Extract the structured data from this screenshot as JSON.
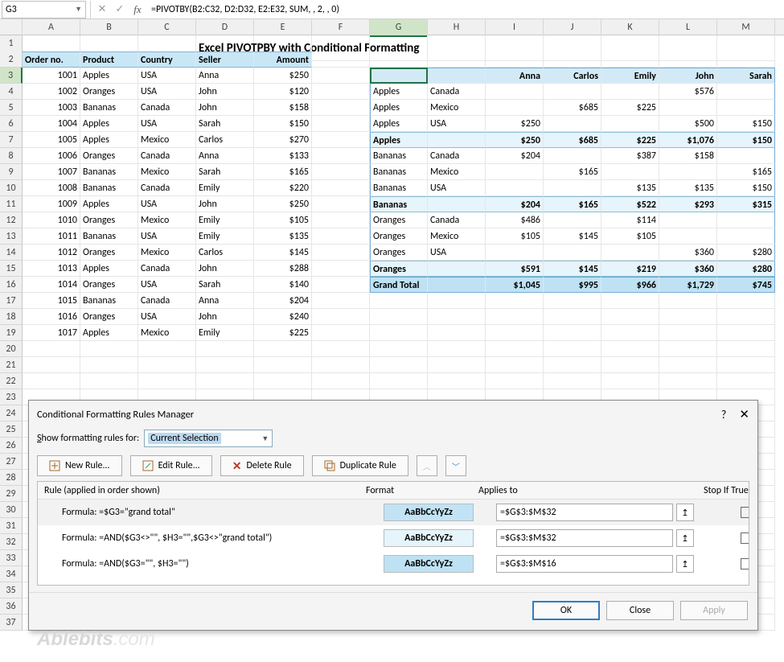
{
  "name_box": "G3",
  "fx_label": "fx",
  "formula": "=PIVOTBY(B2:C32, D2:D32, E2:E32, SUM, , 2, , 0)",
  "columns": [
    "A",
    "B",
    "C",
    "D",
    "E",
    "F",
    "G",
    "H",
    "I",
    "J",
    "K",
    "L",
    "M"
  ],
  "title": "Excel PIVOTPBY with Conditional Formatting",
  "src_headers": [
    "Order no.",
    "Product",
    "Country",
    "Seller",
    "Amount"
  ],
  "src_rows": [
    [
      "1001",
      "Apples",
      "USA",
      "Anna",
      "$250"
    ],
    [
      "1002",
      "Oranges",
      "USA",
      "John",
      "$120"
    ],
    [
      "1003",
      "Bananas",
      "Canada",
      "John",
      "$158"
    ],
    [
      "1004",
      "Apples",
      "USA",
      "Sarah",
      "$150"
    ],
    [
      "1005",
      "Apples",
      "Mexico",
      "Carlos",
      "$270"
    ],
    [
      "1006",
      "Oranges",
      "Canada",
      "Anna",
      "$133"
    ],
    [
      "1007",
      "Bananas",
      "Mexico",
      "Sarah",
      "$165"
    ],
    [
      "1008",
      "Bananas",
      "Canada",
      "Emily",
      "$220"
    ],
    [
      "1009",
      "Apples",
      "USA",
      "John",
      "$250"
    ],
    [
      "1010",
      "Oranges",
      "Mexico",
      "Emily",
      "$105"
    ],
    [
      "1011",
      "Bananas",
      "USA",
      "Emily",
      "$135"
    ],
    [
      "1012",
      "Oranges",
      "Mexico",
      "Carlos",
      "$145"
    ],
    [
      "1013",
      "Apples",
      "Canada",
      "John",
      "$288"
    ],
    [
      "1014",
      "Oranges",
      "USA",
      "Sarah",
      "$140"
    ],
    [
      "1015",
      "Bananas",
      "Canada",
      "Anna",
      "$204"
    ],
    [
      "1016",
      "Oranges",
      "USA",
      "John",
      "$240"
    ],
    [
      "1017",
      "Apples",
      "Mexico",
      "Emily",
      "$225"
    ]
  ],
  "pivot": {
    "col_headers": [
      "",
      "",
      "Anna",
      "Carlos",
      "Emily",
      "John",
      "Sarah"
    ],
    "rows": [
      {
        "type": "data",
        "cells": [
          "Apples",
          "Canada",
          "",
          "",
          "",
          "$576",
          ""
        ]
      },
      {
        "type": "data",
        "cells": [
          "Apples",
          "Mexico",
          "",
          "$685",
          "$225",
          "",
          ""
        ]
      },
      {
        "type": "data",
        "cells": [
          "Apples",
          "USA",
          "$250",
          "",
          "",
          "$500",
          "$150"
        ]
      },
      {
        "type": "sub",
        "cells": [
          "Apples",
          "",
          "$250",
          "$685",
          "$225",
          "$1,076",
          "$150"
        ]
      },
      {
        "type": "data",
        "cells": [
          "Bananas",
          "Canada",
          "$204",
          "",
          "$387",
          "$158",
          ""
        ]
      },
      {
        "type": "data",
        "cells": [
          "Bananas",
          "Mexico",
          "",
          "$165",
          "",
          "",
          "$165"
        ]
      },
      {
        "type": "data",
        "cells": [
          "Bananas",
          "USA",
          "",
          "",
          "$135",
          "$135",
          "$150"
        ]
      },
      {
        "type": "sub",
        "cells": [
          "Bananas",
          "",
          "$204",
          "$165",
          "$522",
          "$293",
          "$315"
        ]
      },
      {
        "type": "data",
        "cells": [
          "Oranges",
          "Canada",
          "$486",
          "",
          "$114",
          "",
          ""
        ]
      },
      {
        "type": "data",
        "cells": [
          "Oranges",
          "Mexico",
          "$105",
          "$145",
          "$105",
          "",
          ""
        ]
      },
      {
        "type": "data",
        "cells": [
          "Oranges",
          "USA",
          "",
          "",
          "",
          "$360",
          "$280"
        ]
      },
      {
        "type": "sub",
        "cells": [
          "Oranges",
          "",
          "$591",
          "$145",
          "$219",
          "$360",
          "$280"
        ]
      },
      {
        "type": "grand",
        "cells": [
          "Grand Total",
          "",
          "$1,045",
          "$995",
          "$966",
          "$1,729",
          "$745"
        ]
      }
    ]
  },
  "dialog": {
    "title": "Conditional Formatting Rules Manager",
    "rules_for_label": "Show formatting rules for:",
    "rules_for_value": "Current Selection",
    "btn_new": "New Rule...",
    "btn_edit": "Edit Rule...",
    "btn_delete": "Delete Rule",
    "btn_dup": "Duplicate Rule",
    "hdr_rule": "Rule (applied in order shown)",
    "hdr_format": "Format",
    "hdr_applies": "Applies to",
    "hdr_stop": "Stop If True",
    "sample": "AaBbCcYyZz",
    "rules": [
      {
        "formula": "Formula: =$G3=\"grand total\"",
        "applies": "=$G$3:$M$32",
        "variant": "v1"
      },
      {
        "formula": "Formula: =AND($G3<>\"\", $H3=\"\",$G3<>\"grand total\")",
        "applies": "=$G$3:$M$32",
        "variant": "v2"
      },
      {
        "formula": "Formula: =AND($G3=\"\", $H3=\"\")",
        "applies": "=$G$3:$M$16",
        "variant": "v3"
      }
    ],
    "ok": "OK",
    "close": "Close",
    "apply": "Apply"
  },
  "watermark_a": "Ablebits",
  "watermark_b": ".com",
  "row_count": 37
}
